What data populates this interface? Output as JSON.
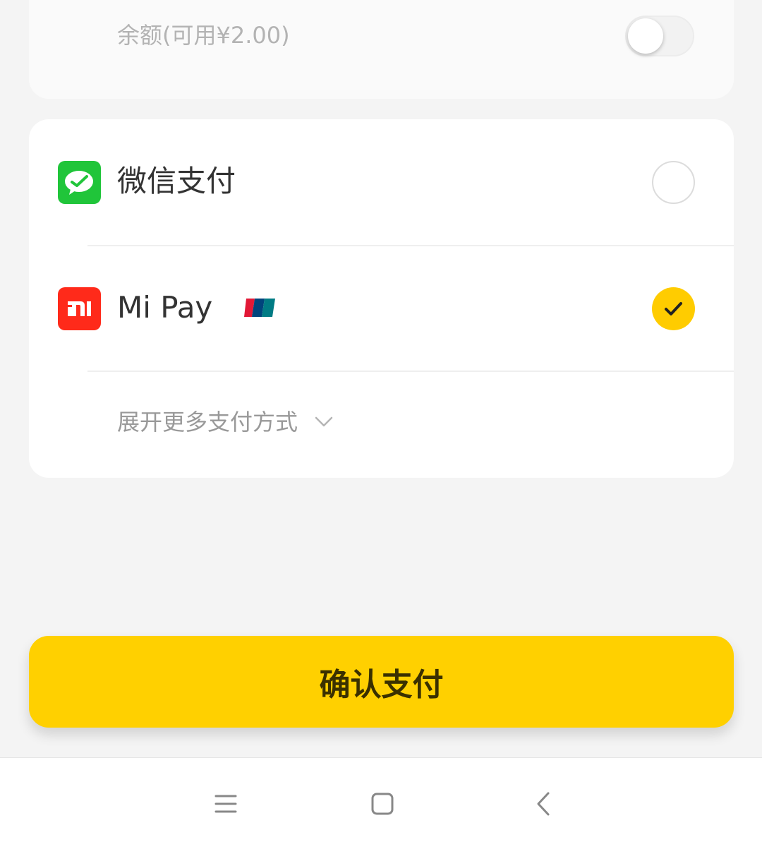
{
  "balance": {
    "label": "余额(可用¥2.00)",
    "toggle_on": false
  },
  "payment_methods": [
    {
      "label": "微信支付",
      "icon": "wechat-icon",
      "selected": false
    },
    {
      "label": "Mi Pay",
      "icon": "mi-icon",
      "badge_icon": "unionpay-icon",
      "selected": true
    }
  ],
  "expand": {
    "label": "展开更多支付方式",
    "icon": "chevron-down-icon"
  },
  "confirm": {
    "label": "确认支付"
  },
  "nav": {
    "icons": [
      "menu-icon",
      "home-icon",
      "back-icon"
    ]
  },
  "colors": {
    "accent": "#ffd000",
    "wechat": "#20c53a",
    "mi": "#ff2a1a",
    "background": "#f4f4f4"
  }
}
